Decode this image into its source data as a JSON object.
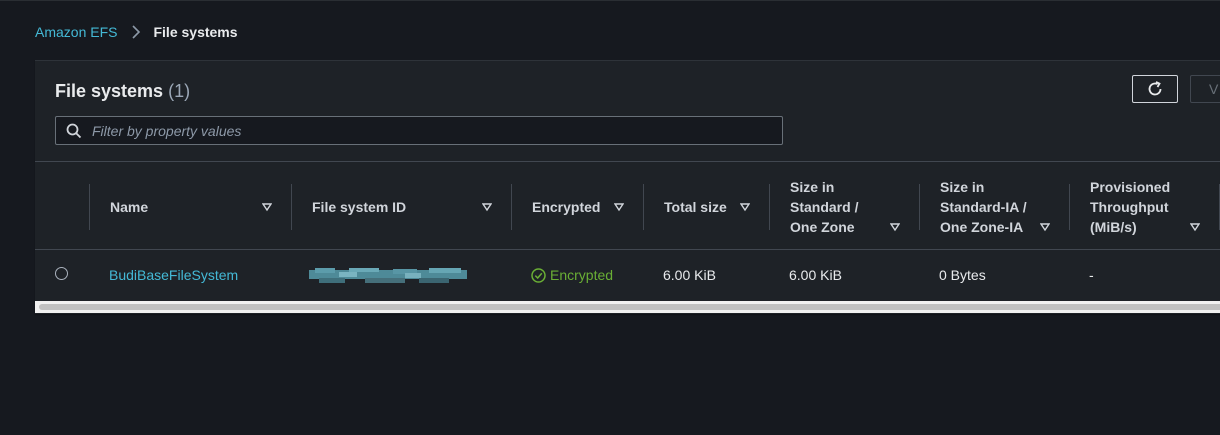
{
  "breadcrumb": {
    "root": "Amazon EFS",
    "current": "File systems"
  },
  "panel": {
    "title": "File systems",
    "count": "(1)",
    "view_button_label": "V",
    "search_placeholder": "Filter by property values"
  },
  "table": {
    "columns": [
      {
        "label": "Name"
      },
      {
        "label": "File system ID"
      },
      {
        "label": "Encrypted"
      },
      {
        "label": "Total size"
      },
      {
        "label": "Size in Standard / One Zone"
      },
      {
        "label": "Size in Standard-IA / One Zone-IA"
      },
      {
        "label": "Provisioned Throughput (MiB/s)"
      }
    ],
    "column_lines": {
      "size_std": [
        "Size in",
        "Standard /",
        "One Zone"
      ],
      "size_ia": [
        "Size in",
        "Standard-IA /",
        "One Zone-IA"
      ],
      "throughput": [
        "Provisioned",
        "Throughput",
        "(MiB/s)"
      ]
    },
    "rows": [
      {
        "name": "BudiBaseFileSystem",
        "file_system_id": "",
        "encrypted": "Encrypted",
        "total_size": "6.00 KiB",
        "size_standard": "6.00 KiB",
        "size_ia": "0 Bytes",
        "throughput": "-"
      }
    ]
  },
  "icons": {
    "breadcrumb_separator": "chevron-right-icon",
    "refresh": "refresh-icon",
    "search": "search-icon",
    "sort": "caret-down-icon",
    "encrypted": "check-circle-icon"
  },
  "colors": {
    "link": "#44b9d6",
    "success": "#6aaf35",
    "background": "#16191f",
    "panel": "#1e2227"
  }
}
